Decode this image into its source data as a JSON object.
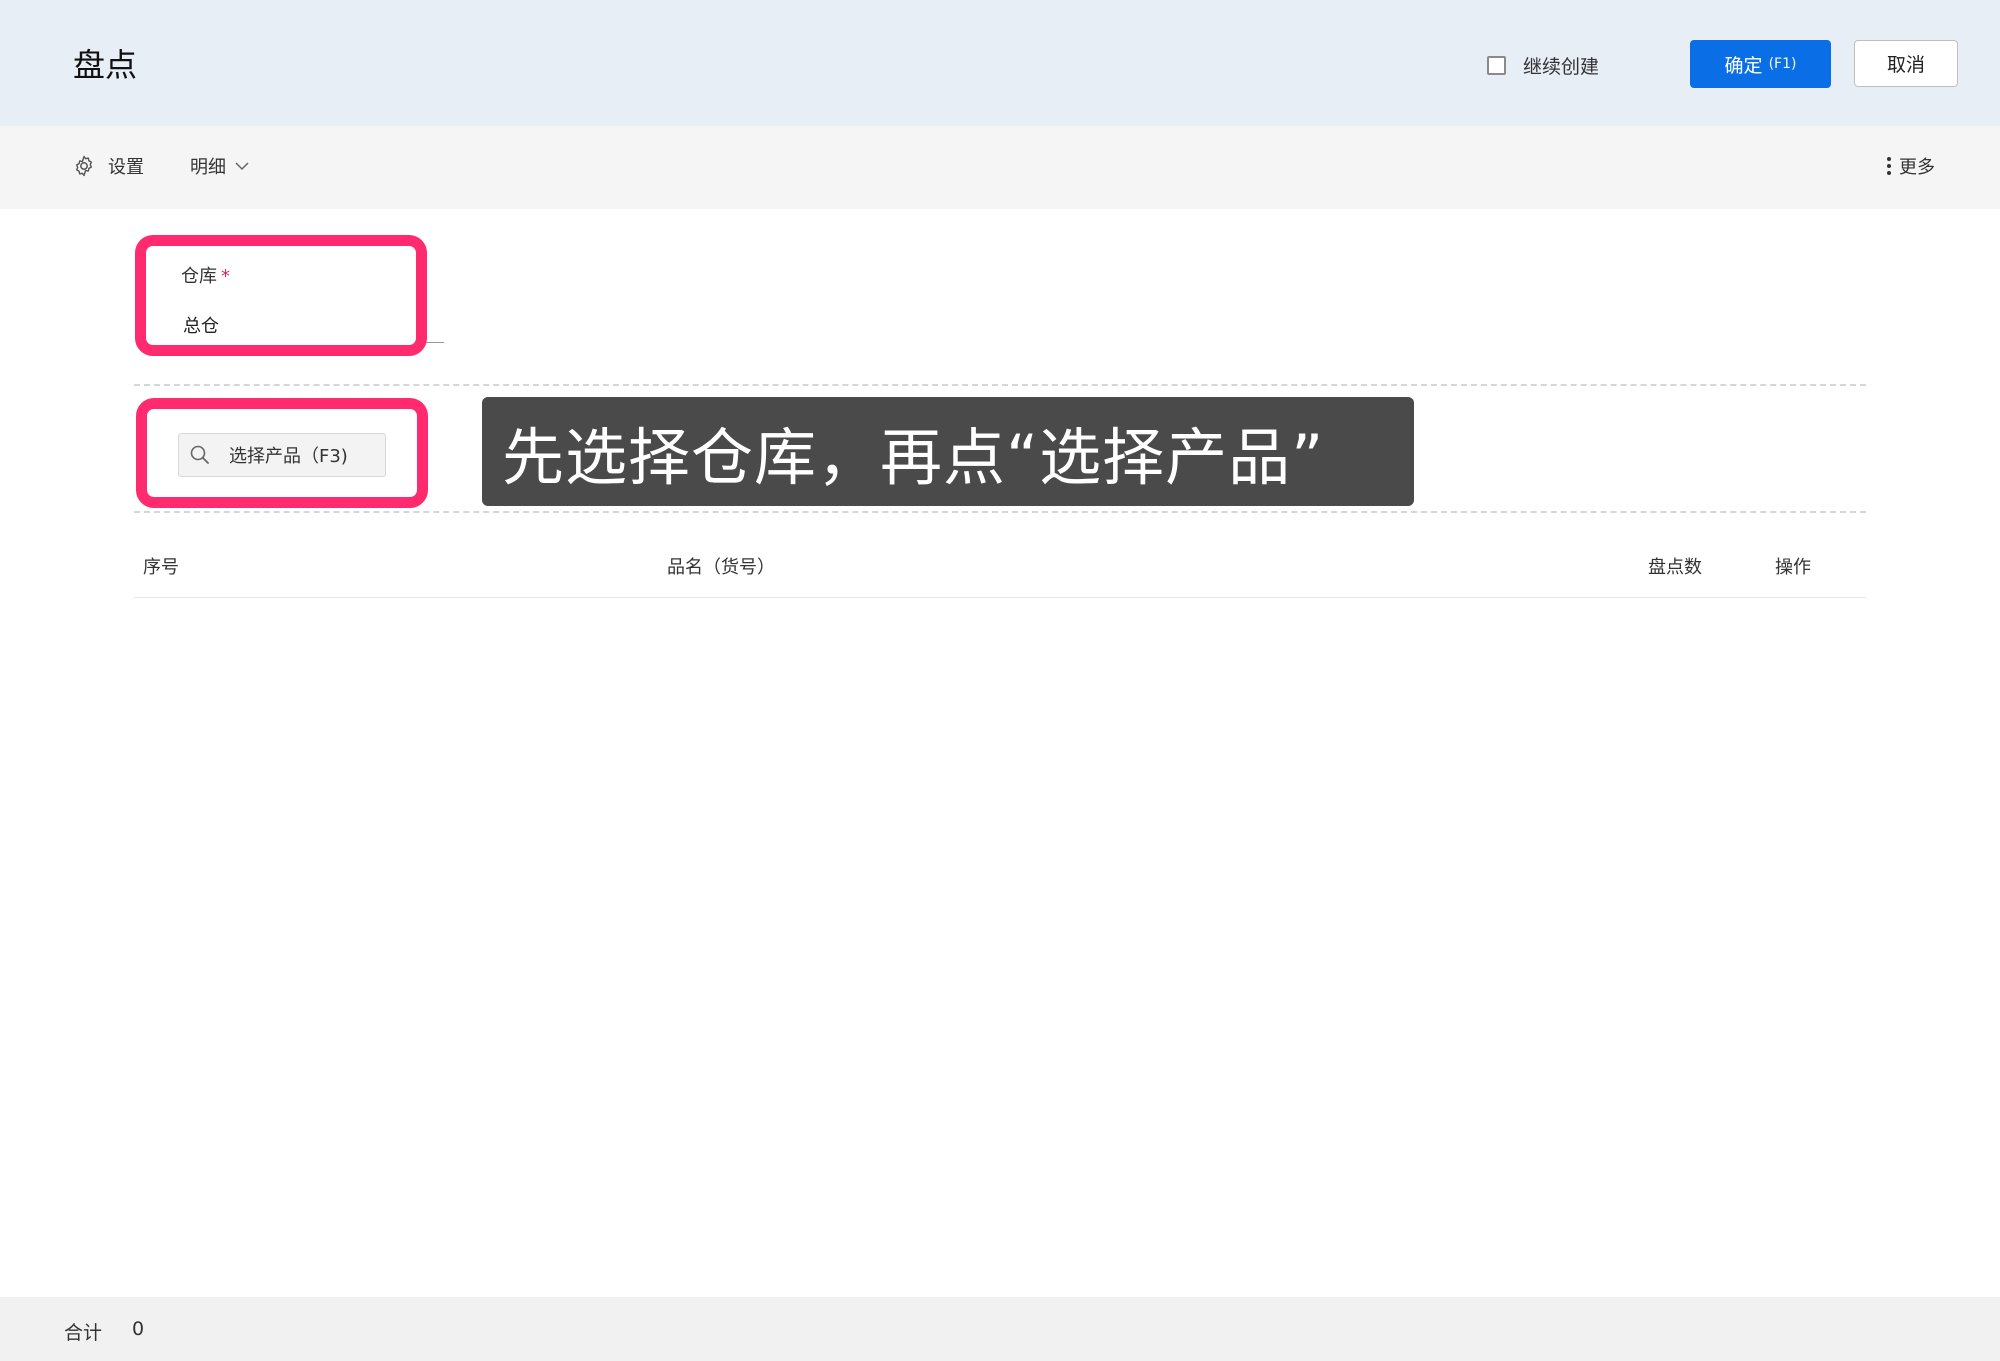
{
  "header": {
    "title": "盘点",
    "continue_create_label": "继续创建",
    "continue_create_checked": false,
    "ok_label": "确定",
    "ok_shortcut": "(F1)",
    "cancel_label": "取消",
    "accent_color": "#0a6fe6"
  },
  "toolbar": {
    "settings_icon": "gear-icon",
    "settings_label": "设置",
    "detail_label": "明细",
    "detail_icon": "chevron-down-icon",
    "more_icon": "kebab-icon",
    "more_label": "更多"
  },
  "form": {
    "warehouse_label": "仓库",
    "warehouse_required_mark": "*",
    "warehouse_value": "总仓",
    "product_picker_icon": "search-icon",
    "product_picker_label": "选择产品（F3)"
  },
  "annotation": {
    "text": "先选择仓库，再点“选择产品”",
    "highlight_color": "#ff2b6e"
  },
  "table": {
    "columns": [
      "序号",
      "品名（货号）",
      "盘点数",
      "操作"
    ],
    "rows": []
  },
  "footer": {
    "total_label": "合计",
    "total_value": "0"
  }
}
